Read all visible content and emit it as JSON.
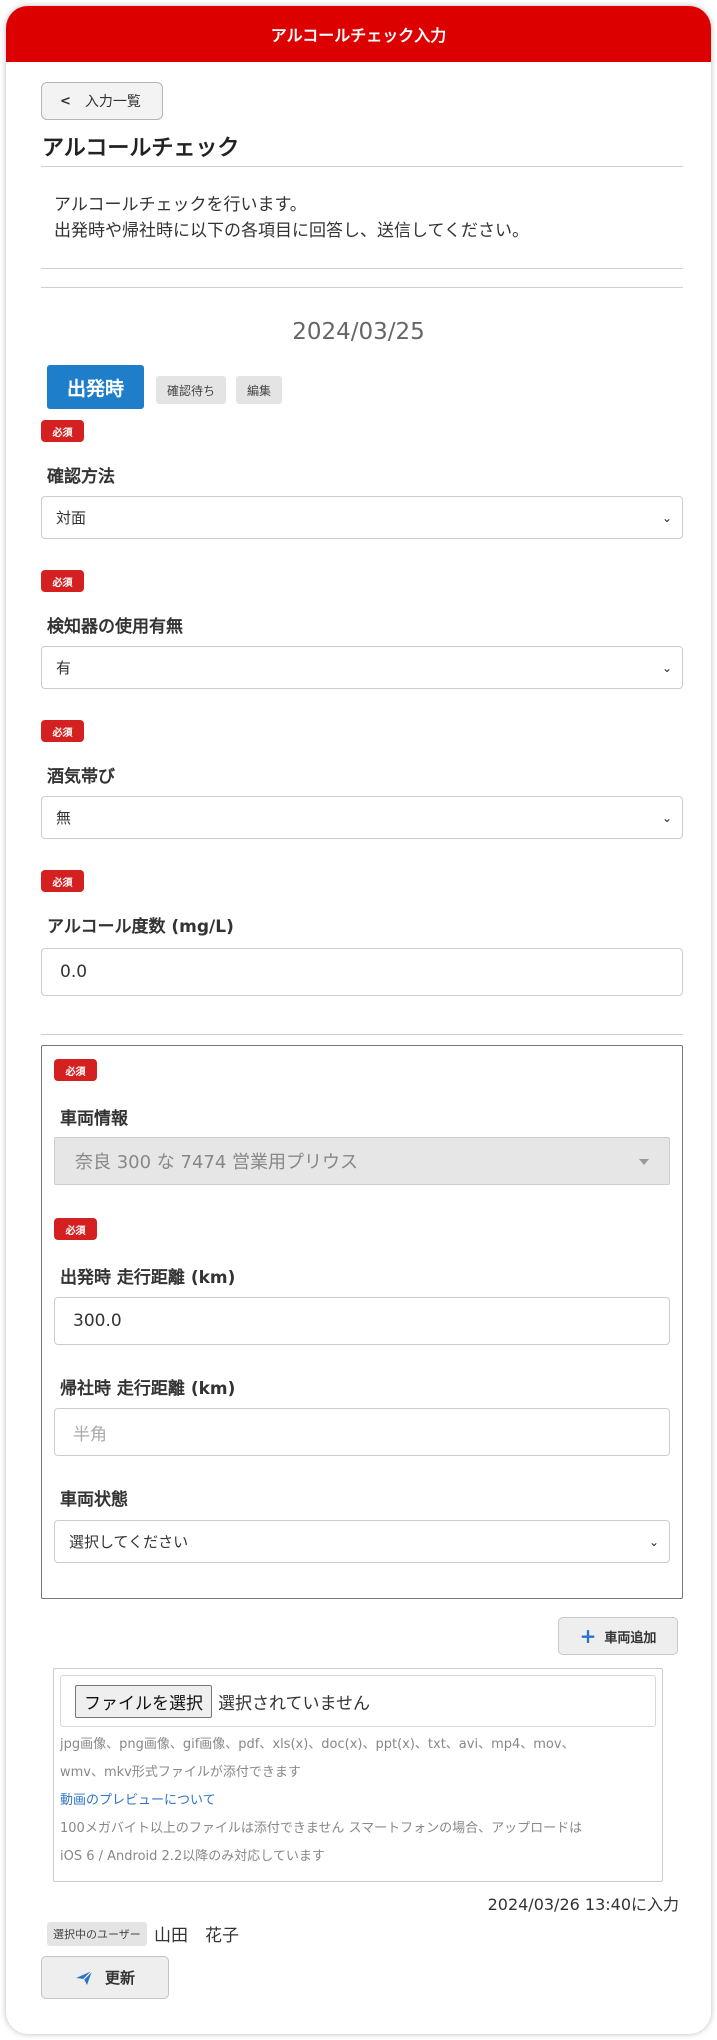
{
  "header": {
    "title": "アルコールチェック入力"
  },
  "nav": {
    "back_label": "入力一覧",
    "back_icon": "chevron-left-icon"
  },
  "page": {
    "title": "アルコールチェック",
    "intro_line1": "アルコールチェックを行います。",
    "intro_line2": "出発時や帰社時に以下の各項目に回答し、送信してください。"
  },
  "record": {
    "date": "2024/03/25",
    "type_badge": "出発時",
    "status_badge": "確認待ち",
    "edit_badge": "編集"
  },
  "required_label": "必須",
  "fields": {
    "method": {
      "label": "確認方法",
      "value": "対面"
    },
    "detector": {
      "label": "検知器の使用有無",
      "value": "有"
    },
    "drunk": {
      "label": "酒気帯び",
      "value": "無"
    },
    "alcohol": {
      "label": "アルコール度数 (mg/L)",
      "value": "0.0"
    }
  },
  "vehicle": {
    "info_label": "車両情報",
    "info_value": "奈良 300 な 7474 営業用プリウス",
    "depart_distance_label": "出発時 走行距離 (km)",
    "depart_distance_value": "300.0",
    "return_distance_label": "帰社時 走行距離 (km)",
    "return_distance_placeholder": "半角",
    "condition_label": "車両状態",
    "condition_value": "選択してください"
  },
  "add_vehicle_label": "車両追加",
  "upload": {
    "button_label": "ファイルを選択",
    "status": "選択されていません",
    "note1": "jpg画像、png画像、gif画像、pdf、xls(x)、doc(x)、ppt(x)、txt、avi、mp4、mov、",
    "note2": "wmv、mkv形式ファイルが添付できます",
    "link": "動画のプレビューについて",
    "note3": "100メガバイト以上のファイルは添付できません スマートフォンの場合、アップロードは",
    "note4": "iOS 6 / Android 2.2以降のみ対応しています"
  },
  "footer": {
    "entered_at": "2024/03/26 13:40に入力",
    "selected_user_tag": "選択中のユーザー",
    "user_name": "山田　花子",
    "update_label": "更新"
  },
  "colors": {
    "header": "#dd0000",
    "required": "#d42020",
    "depart_badge": "#1e7ec9",
    "link": "#2f75c8"
  }
}
